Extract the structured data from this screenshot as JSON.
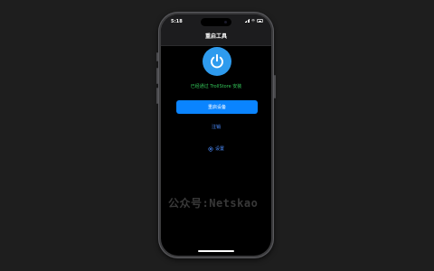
{
  "status_bar": {
    "time": "5:18"
  },
  "nav": {
    "title": "重启工具"
  },
  "main": {
    "power_icon": "power-icon",
    "status_text": "已经通过 TrollStore 安装",
    "primary_button_label": "重启设备",
    "link_button_label": "注销",
    "settings_label": "设置",
    "settings_icon": "gear-icon"
  },
  "overlay": {
    "watermark": "公众号:Netskao"
  },
  "colors": {
    "accent": "#0a84ff",
    "power_circle": "#2e9bee",
    "status_green": "#34c759",
    "background": "#000000",
    "page_background": "#1e1e1e"
  }
}
